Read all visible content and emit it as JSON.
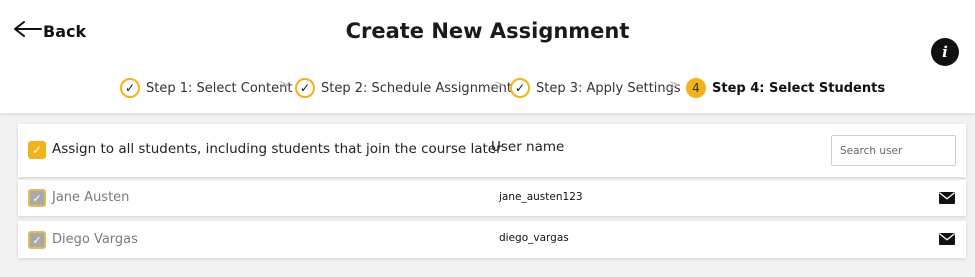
{
  "header": {
    "back_label": "Back",
    "title": "Create New Assignment",
    "info_glyph": "i"
  },
  "steps": [
    {
      "number": "✓",
      "label": "Step 1: Select Content",
      "state": "complete"
    },
    {
      "number": "✓",
      "label": "Step 2: Schedule Assignment",
      "state": "complete"
    },
    {
      "number": "✓",
      "label": "Step 3: Apply Settings",
      "state": "complete"
    },
    {
      "number": "4",
      "label": "Step 4: Select Students",
      "state": "active"
    }
  ],
  "step_separator": ">",
  "assign_all": {
    "checked": true,
    "label": "Assign to all students, including students that join the course later"
  },
  "columns": {
    "username_header": "User name"
  },
  "search": {
    "placeholder": "Search user"
  },
  "students": [
    {
      "name": "Jane Austen",
      "username": "jane_austen123",
      "checked": true,
      "action_icon": "envelope-icon"
    },
    {
      "name": "Diego Vargas",
      "username": "diego_vargas",
      "checked": true,
      "action_icon": "envelope-icon"
    }
  ],
  "colors": {
    "accent": "#f2b21b",
    "disabled_check": "#a9a9a9",
    "background": "#f2f2f2"
  }
}
